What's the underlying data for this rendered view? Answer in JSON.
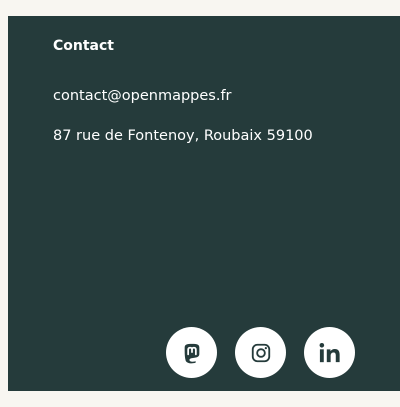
{
  "contact": {
    "heading": "Contact",
    "email": "contact@openmappes.fr",
    "address": "87 rue de Fontenoy, Roubaix 59100"
  },
  "socials": [
    {
      "icon": "mastodon-icon"
    },
    {
      "icon": "instagram-icon"
    },
    {
      "icon": "linkedin-icon"
    }
  ],
  "colors": {
    "panel_background": "#253b3b",
    "page_background": "#f8f6f1",
    "text": "#ffffff",
    "icon": "#253b3b"
  }
}
